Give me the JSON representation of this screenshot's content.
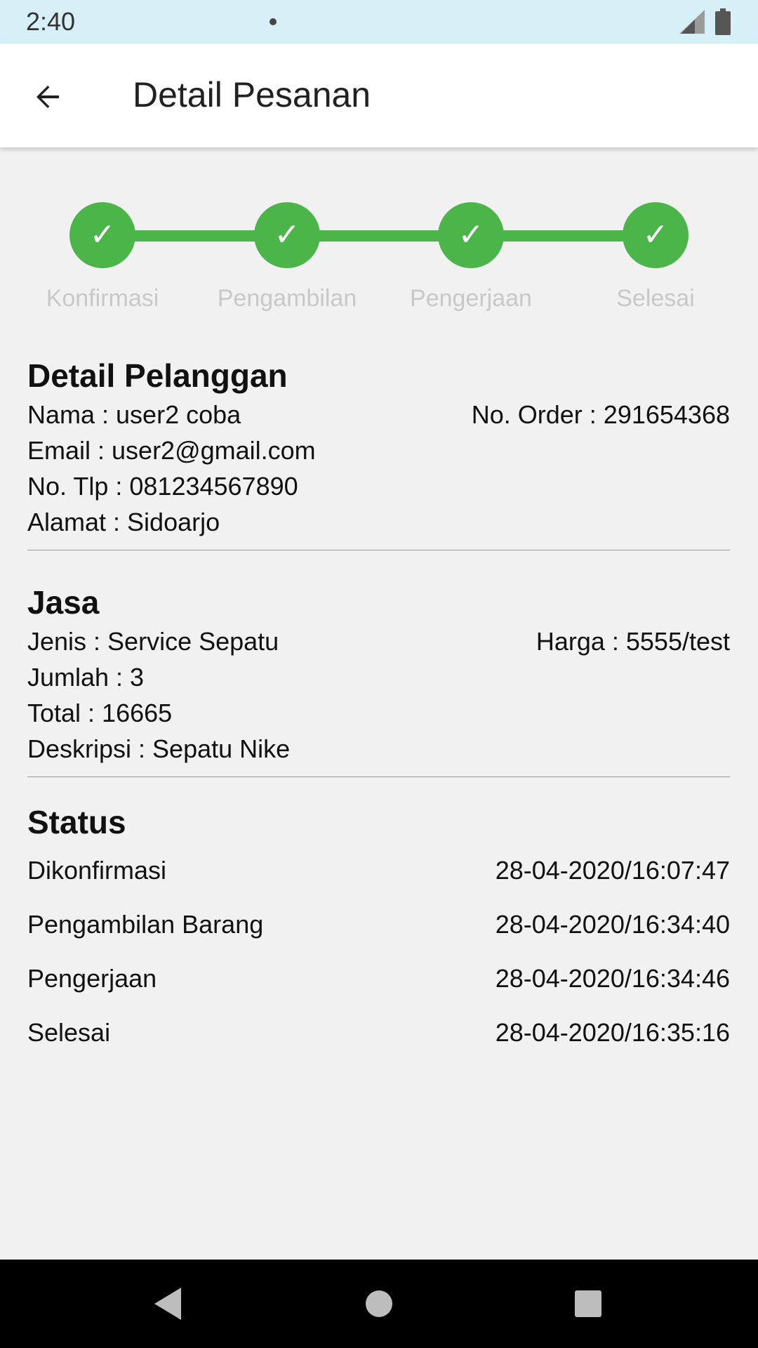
{
  "status_bar": {
    "time": "2:40"
  },
  "app_bar": {
    "title": "Detail Pesanan"
  },
  "stepper": {
    "accent": "#4cb54a",
    "steps": [
      {
        "label": "Konfirmasi",
        "done": true
      },
      {
        "label": "Pengambilan",
        "done": true
      },
      {
        "label": "Pengerjaan",
        "done": true
      },
      {
        "label": "Selesai",
        "done": true
      }
    ],
    "check": "✓"
  },
  "customer": {
    "title": "Detail Pelanggan",
    "nama": "Nama : user2 coba",
    "order": "No. Order : 291654368",
    "email": "Email : user2@gmail.com",
    "phone": "No. Tlp : 081234567890",
    "address": "Alamat : Sidoarjo"
  },
  "service": {
    "title": "Jasa",
    "jenis": "Jenis : Service Sepatu",
    "harga": "Harga : 5555/test",
    "jumlah": "Jumlah : 3",
    "total": "Total : 16665",
    "deskripsi": "Deskripsi : Sepatu Nike"
  },
  "status": {
    "title": "Status",
    "items": [
      {
        "label": "Dikonfirmasi",
        "time": "28-04-2020/16:07:47"
      },
      {
        "label": "Pengambilan Barang",
        "time": "28-04-2020/16:34:40"
      },
      {
        "label": "Pengerjaan",
        "time": "28-04-2020/16:34:46"
      },
      {
        "label": "Selesai",
        "time": "28-04-2020/16:35:16"
      }
    ]
  },
  "icons": {
    "back": "arrow-left-icon",
    "signal": "signal-icon",
    "battery": "battery-icon",
    "nav_back": "triangle-back-icon",
    "nav_home": "circle-home-icon",
    "nav_recents": "square-recents-icon"
  }
}
